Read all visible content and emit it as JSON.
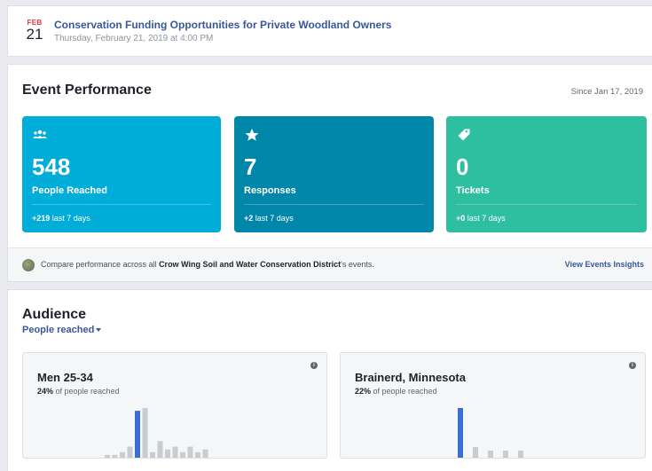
{
  "event": {
    "month": "FEB",
    "day": "21",
    "title": "Conservation Funding Opportunities for Private Woodland Owners",
    "datetime": "Thursday, February 21, 2019 at 4:00 PM"
  },
  "performance": {
    "title": "Event Performance",
    "since": "Since Jan 17, 2019",
    "cards": [
      {
        "icon": "people-icon",
        "value": "548",
        "label": "People Reached",
        "delta": "+219",
        "delta_suffix": " last 7 days",
        "color": "#00acd8"
      },
      {
        "icon": "star-icon",
        "value": "7",
        "label": "Responses",
        "delta": "+2",
        "delta_suffix": " last 7 days",
        "color": "#0086a8"
      },
      {
        "icon": "ticket-icon",
        "value": "0",
        "label": "Tickets",
        "delta": "+0",
        "delta_suffix": " last 7 days",
        "color": "#2ebea0"
      }
    ],
    "compare": {
      "prefix": "Compare performance across all ",
      "org": "Crow Wing Soil and Water Conservation District",
      "suffix": "'s events.",
      "link": "View Events Insights"
    }
  },
  "audience": {
    "title": "Audience",
    "selector": "People reached",
    "cards": [
      {
        "heading": "Men 25-34",
        "percent": "24%",
        "percent_suffix": " of people reached",
        "info": "i"
      },
      {
        "heading": "Brainerd, Minnesota",
        "percent": "22%",
        "percent_suffix": " of people reached",
        "info": "i"
      }
    ]
  },
  "chart_data": [
    {
      "type": "bar",
      "values": [
        0.5,
        0.5,
        1,
        2,
        8.5,
        9,
        1,
        3,
        1.5,
        2,
        1,
        2,
        1,
        1.5
      ],
      "highlight_index": 4
    },
    {
      "type": "bar",
      "values": [
        7,
        1.5,
        1,
        1,
        1
      ],
      "highlight_index": 0
    }
  ]
}
